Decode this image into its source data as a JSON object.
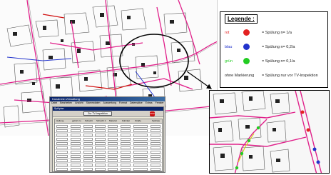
{
  "legend": {
    "title": "Legende :",
    "items": [
      {
        "name": "rot",
        "color": "#e32222",
        "name_color": "#e32222",
        "text": "= Spülung n= 1/a"
      },
      {
        "name": "blau",
        "color": "#2233cc",
        "name_color": "#2233cc",
        "text": "= Spülung n= 0,2/a"
      },
      {
        "name": "grün",
        "color": "#22cc22",
        "name_color": "#22cc22",
        "text": "= Spülung n= 0,1/a"
      },
      {
        "name": "ohne Markierung",
        "color": null,
        "name_color": "#222222",
        "text": "= Spülung nur vor TV-Inspektion"
      }
    ]
  },
  "app": {
    "window_title": "Kanalnetz-Verwaltung",
    "menu": [
      "Datei",
      "Bearbeiten",
      "Ansicht",
      "Stammdaten",
      "Auswertung",
      "Format",
      "Datensätze",
      "Extras",
      "Fenster",
      "?"
    ],
    "inner_title": "Spülplan",
    "toolbar_button": "Zur TV-Inspektion",
    "stop_label": "STOP",
    "columns": [
      "Haltung",
      "gehört zu",
      "Schacht",
      "Schacht 2",
      "Material",
      "Fabrikat",
      "Straße",
      "Spülrate"
    ]
  }
}
